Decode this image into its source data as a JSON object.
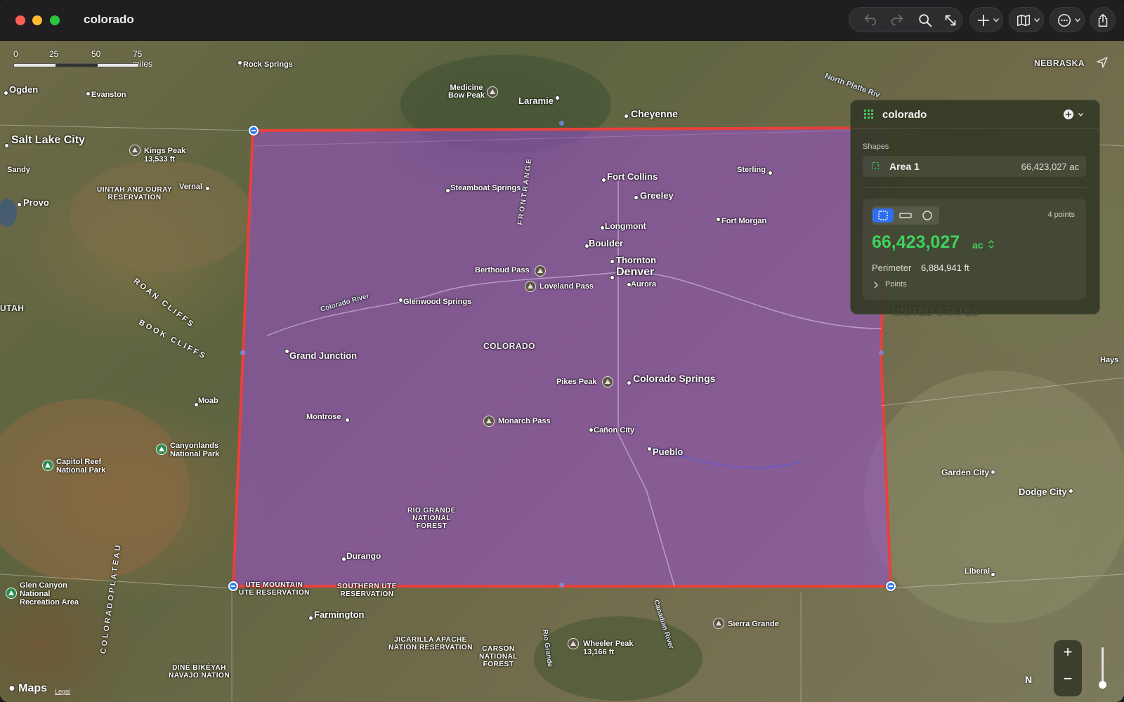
{
  "window": {
    "title": "colorado"
  },
  "toolbar": {
    "undo_icon": "undo-arrow-icon",
    "redo_icon": "redo-arrow-icon",
    "search_icon": "magnifier-icon",
    "measure_icon": "diagonal-arrows-icon",
    "add_icon": "plus-icon",
    "map_mode_icon": "map-icon",
    "more_icon": "ellipsis-circle-icon",
    "share_icon": "share-icon"
  },
  "scale": {
    "ticks": [
      "0",
      "25",
      "50",
      "75 miles"
    ]
  },
  "panel": {
    "title": "colorado",
    "shapes_label": "Shapes",
    "shape": {
      "name": "Area 1",
      "value": "66,423,027 ac"
    },
    "points_count": "4 points",
    "area_value": "66,423,027",
    "area_unit": "ac",
    "perimeter_label": "Perimeter",
    "perimeter_value": "6,884,941 ft",
    "points_label": "Points",
    "accent_color": "#3ed35f",
    "selected_mode_color": "#2e6ef2"
  },
  "map": {
    "labels": {
      "rock_springs": "Rock Springs",
      "ogden": "Ogden",
      "evanston": "Evanston",
      "medicine_bow": "Medicine\nBow Peak",
      "laramie": "Laramie",
      "cheyenne": "Cheyenne",
      "north_platte": "North Platte Riv",
      "nebraska": "NEBRASKA",
      "salt_lake": "Salt Lake City",
      "kings_peak": "Kings Peak\n13,533 ft",
      "sandy": "Sandy",
      "uintah": "UINTAH AND OURAY\nRESERVATION",
      "vernal": "Vernal",
      "provo": "Provo",
      "steamboat": "Steamboat Springs",
      "fort_collins": "Fort Collins",
      "greeley": "Greeley",
      "sterling": "Sterling",
      "longmont": "Longmont",
      "fort_morgan": "Fort Morgan",
      "boulder": "Boulder",
      "thornton": "Thornton",
      "denver": "Denver",
      "aurora": "Aurora",
      "berthoud": "Berthoud Pass",
      "loveland": "Loveland Pass",
      "united_states": "UNITED STATES",
      "utah": "UTAH",
      "colorado_river": "Colorado River",
      "glenwood": "Glenwood Springs",
      "grand_junction": "Grand Junction",
      "colorado": "COLORADO",
      "pikes_peak": "Pikes Peak",
      "colorado_springs": "Colorado Springs",
      "hays": "Hays",
      "moab": "Moab",
      "canyonlands": "Canyonlands\nNational Park",
      "montrose": "Montrose",
      "monarch": "Monarch Pass",
      "canon_city": "Cañon City",
      "capitol_reef": "Capitol Reef\nNational Park",
      "pueblo": "Pueblo",
      "garden_city": "Garden City",
      "dodge_city": "Dodge City",
      "rio_grande_forest": "RIO GRANDE\nNATIONAL\nFOREST",
      "durango": "Durango",
      "glen_canyon": "Glen Canyon\nNational\nRecreation Area",
      "ute_mountain": "UTE MOUNTAIN\nUTE RESERVATION",
      "southern_ute": "SOUTHERN UTE\nRESERVATION",
      "liberal": "Liberal",
      "farmington": "Farmington",
      "jicarilla": "JICARILLA APACHE\nNATION RESERVATION",
      "carson": "CARSON\nNATIONAL\nFOREST",
      "sierra_grande": "Sierra Grande",
      "wheeler_peak": "Wheeler Peak\n13,166 ft",
      "dine_bikeyah": "DINÉ BIKÉYAH\nNAVAJO NATION",
      "front_range": "F R O N T   R A N G E",
      "roan_cliffs": "ROAN CLIFFS",
      "book_cliffs": "BOOK CLIFFS",
      "colorado_plateau": "C O L O R A D O   P L A T E A U",
      "rio_grande_river": "Rio Grande",
      "canadian_river": "Canadian River"
    },
    "polygon": {
      "fill": "#9b4fd0",
      "stroke": "#e8413a"
    }
  },
  "controls": {
    "zoom_in": "+",
    "zoom_out": "−",
    "compass": "N",
    "maps_logo": "Maps",
    "legal": "Legal"
  }
}
